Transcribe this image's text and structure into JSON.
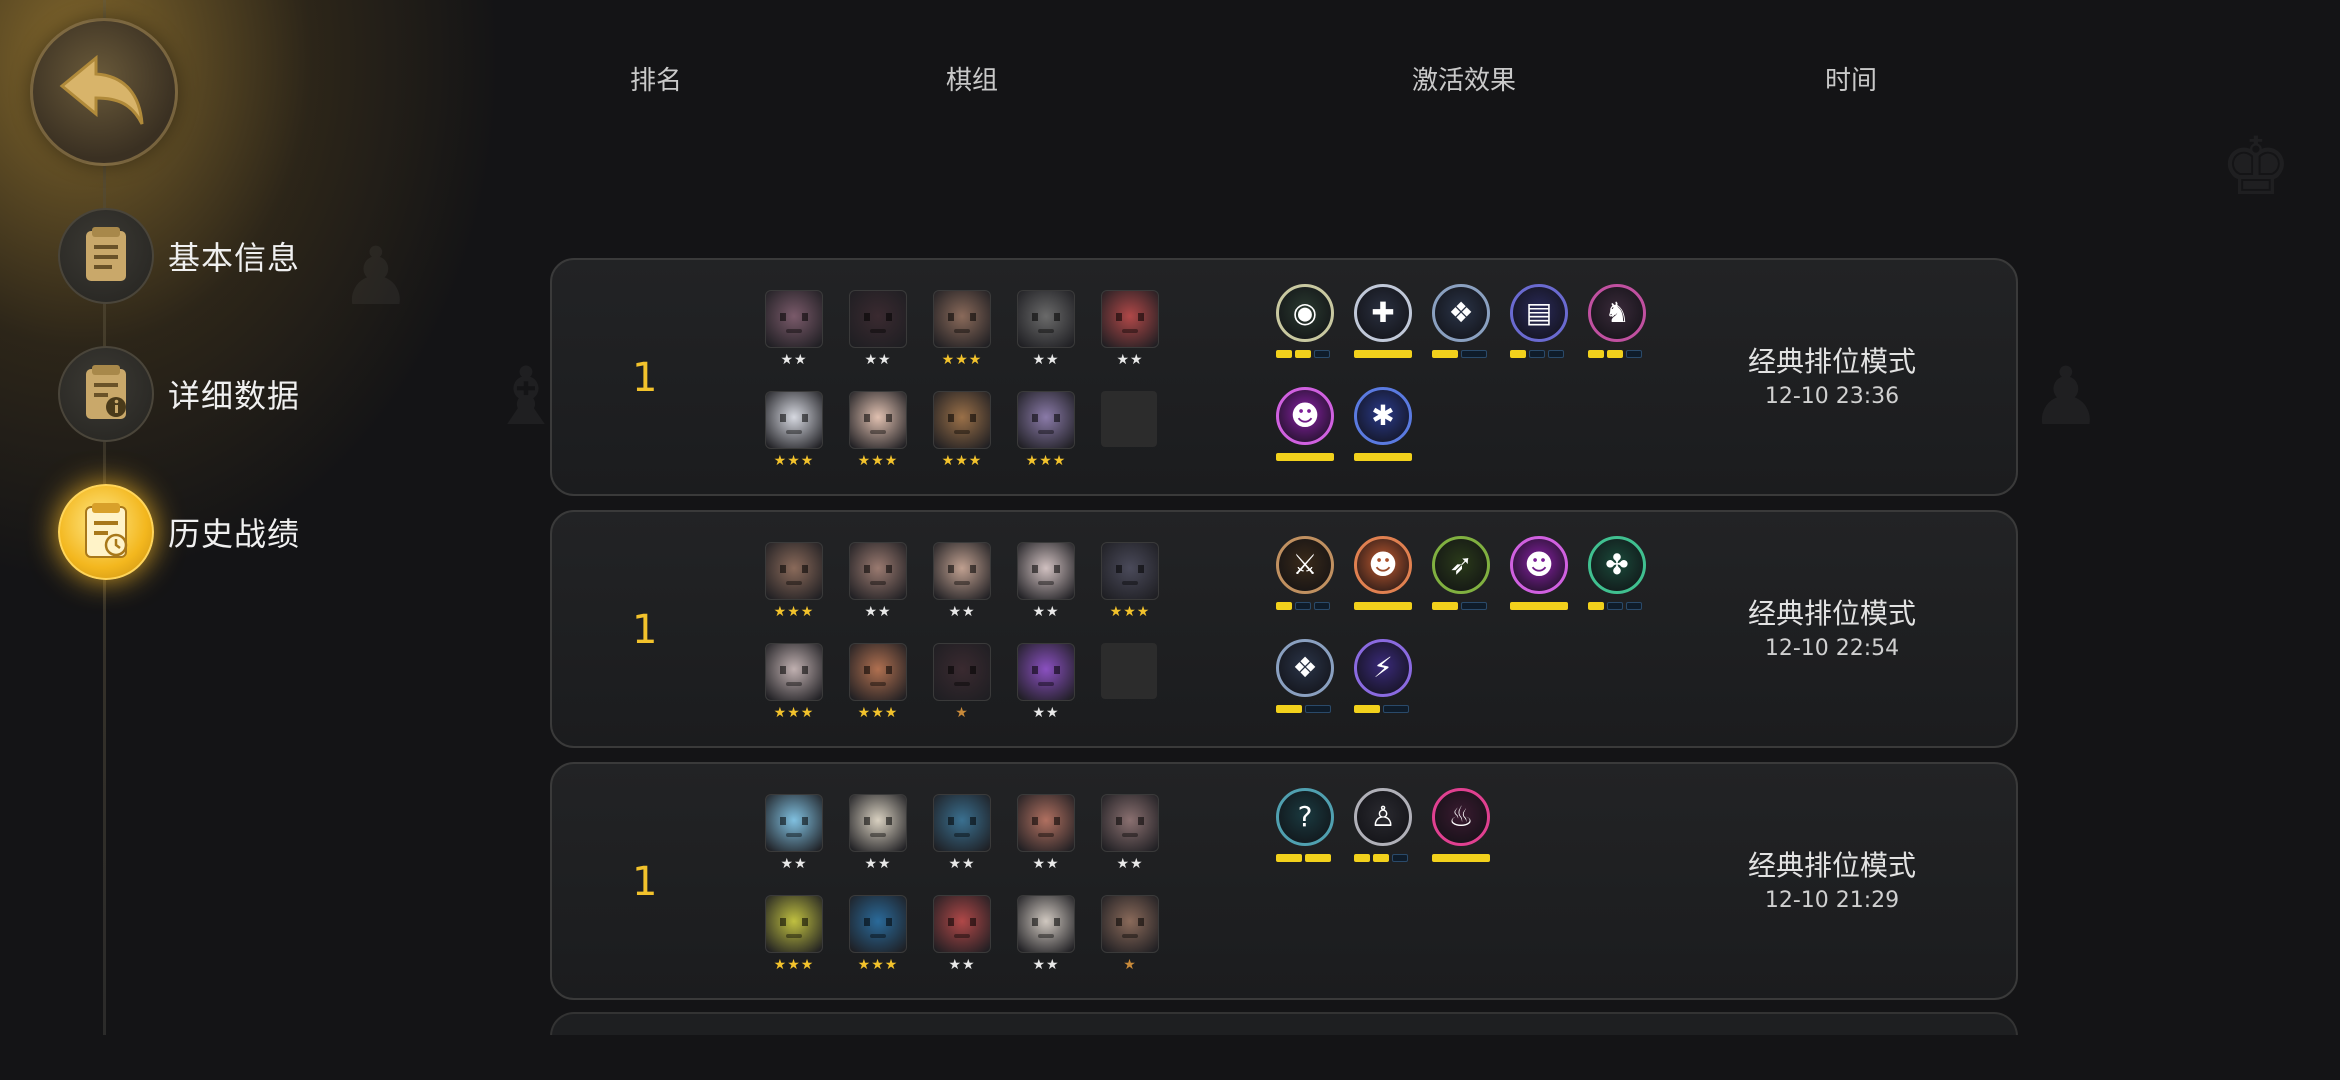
{
  "nav": {
    "back_icon": "back-arrow-icon",
    "items": [
      {
        "label": "基本信息",
        "icon": "document-icon",
        "active": false
      },
      {
        "label": "详细数据",
        "icon": "info-document-icon",
        "active": false
      },
      {
        "label": "历史战绩",
        "icon": "history-clock-icon",
        "active": true
      }
    ]
  },
  "columns": {
    "rank": "排名",
    "lineup": "棋组",
    "effects": "激活效果",
    "time": "时间"
  },
  "colors": {
    "accent_gold": "#f2c22c",
    "synergy_bar_on": "#f2d11c",
    "synergy_bar_off": "#0f1c2a"
  },
  "records": [
    {
      "rank": "1",
      "mode": "经典排位模式",
      "time": "12-10 23:36",
      "heroes": [
        {
          "stars": "★★",
          "tier": "white",
          "color": "#7a5a6a"
        },
        {
          "stars": "★★",
          "tier": "white",
          "color": "#3a2a30"
        },
        {
          "stars": "★★★",
          "tier": "gold",
          "color": "#8a6a5a"
        },
        {
          "stars": "★★",
          "tier": "white",
          "color": "#6a6a6a"
        },
        {
          "stars": "★★",
          "tier": "white",
          "color": "#b04848"
        },
        {
          "stars": "★★★",
          "tier": "gold",
          "color": "#d6d8e0"
        },
        {
          "stars": "★★★",
          "tier": "gold",
          "color": "#e0c0b0"
        },
        {
          "stars": "★★★",
          "tier": "gold",
          "color": "#9a7048"
        },
        {
          "stars": "★★★",
          "tier": "gold",
          "color": "#8a7aa8"
        }
      ],
      "empty_slots": 1,
      "synergies": [
        {
          "icon": "owl-icon",
          "glyph": "◉",
          "bg": "#2a3a30",
          "ring": "#c8c8a0",
          "bars": [
            1,
            1,
            0
          ]
        },
        {
          "icon": "cross-icon",
          "glyph": "✚",
          "bg": "#2a3040",
          "ring": "#c0c8d8",
          "bars": [
            1
          ]
        },
        {
          "icon": "paw-cluster-icon",
          "glyph": "❖",
          "bg": "#2a3448",
          "ring": "#8aa0c0",
          "bars": [
            1,
            0
          ]
        },
        {
          "icon": "book-icon",
          "glyph": "▤",
          "bg": "#2a2a5a",
          "ring": "#6a6ad0",
          "bars": [
            1,
            0,
            0
          ]
        },
        {
          "icon": "knight-icon",
          "glyph": "♞",
          "bg": "#3a2a3a",
          "ring": "#c050a0",
          "bars": [
            1,
            1,
            0
          ]
        },
        {
          "icon": "demon-icon",
          "glyph": "☻",
          "bg": "#8a20a8",
          "ring": "#d060e0",
          "bars": [
            1
          ]
        },
        {
          "icon": "shatter-icon",
          "glyph": "✱",
          "bg": "#2a3a8a",
          "ring": "#5a7ae0",
          "bars": [
            1
          ]
        }
      ]
    },
    {
      "rank": "1",
      "mode": "经典排位模式",
      "time": "12-10 22:54",
      "heroes": [
        {
          "stars": "★★★",
          "tier": "gold",
          "color": "#8a6a5a"
        },
        {
          "stars": "★★",
          "tier": "white",
          "color": "#9a7a70"
        },
        {
          "stars": "★★",
          "tier": "white",
          "color": "#c0a090"
        },
        {
          "stars": "★★",
          "tier": "white",
          "color": "#d0c0c0"
        },
        {
          "stars": "★★★",
          "tier": "gold",
          "color": "#4a4a5a"
        },
        {
          "stars": "★★★",
          "tier": "gold",
          "color": "#c0b0b0"
        },
        {
          "stars": "★★★",
          "tier": "gold",
          "color": "#b07050"
        },
        {
          "stars": "★",
          "tier": "bronze",
          "color": "#3a2a30"
        },
        {
          "stars": "★★",
          "tier": "white",
          "color": "#8a50c0"
        }
      ],
      "empty_slots": 1,
      "synergies": [
        {
          "icon": "beast-warrior-icon",
          "glyph": "⚔",
          "bg": "#3a2a1a",
          "ring": "#c09060",
          "bars": [
            1,
            0,
            0
          ]
        },
        {
          "icon": "horned-icon",
          "glyph": "☻",
          "bg": "#c05a30",
          "ring": "#e08050",
          "bars": [
            1
          ]
        },
        {
          "icon": "bow-icon",
          "glyph": "➶",
          "bg": "#2a3a1a",
          "ring": "#80b040",
          "bars": [
            1,
            0
          ]
        },
        {
          "icon": "demon-icon",
          "glyph": "☻",
          "bg": "#8a20a8",
          "ring": "#d060e0",
          "bars": [
            1
          ]
        },
        {
          "icon": "pawprint-icon",
          "glyph": "✤",
          "bg": "#1a4a3a",
          "ring": "#40c090",
          "bars": [
            1,
            0,
            0
          ]
        },
        {
          "icon": "paw-cluster-icon",
          "glyph": "❖",
          "bg": "#2a3448",
          "ring": "#8aa0c0",
          "bars": [
            1,
            0
          ]
        },
        {
          "icon": "fishbone-icon",
          "glyph": "⚡",
          "bg": "#3a2a7a",
          "ring": "#8a6ae0",
          "bars": [
            1,
            0
          ]
        }
      ]
    },
    {
      "rank": "1",
      "mode": "经典排位模式",
      "time": "12-10 21:29",
      "heroes": [
        {
          "stars": "★★",
          "tier": "white",
          "color": "#80c0e0"
        },
        {
          "stars": "★★",
          "tier": "white",
          "color": "#d8d0c0"
        },
        {
          "stars": "★★",
          "tier": "white",
          "color": "#3a7090"
        },
        {
          "stars": "★★",
          "tier": "white",
          "color": "#b07060"
        },
        {
          "stars": "★★",
          "tier": "white",
          "color": "#8a7070"
        },
        {
          "stars": "★★★",
          "tier": "gold",
          "color": "#c0c040"
        },
        {
          "stars": "★★★",
          "tier": "gold",
          "color": "#2a6a9a"
        },
        {
          "stars": "★★",
          "tier": "white",
          "color": "#b04848"
        },
        {
          "stars": "★★",
          "tier": "white",
          "color": "#d0c8c0"
        },
        {
          "stars": "★",
          "tier": "bronze",
          "color": "#8a6a5a"
        }
      ],
      "empty_slots": 0,
      "synergies": [
        {
          "icon": "question-icon",
          "glyph": "?",
          "bg": "#1a3a40",
          "ring": "#50a0b0",
          "bars": [
            1,
            1
          ]
        },
        {
          "icon": "pedestal-icon",
          "glyph": "♙",
          "bg": "#2a2a30",
          "ring": "#b0b0b8",
          "bars": [
            1,
            1,
            0
          ]
        },
        {
          "icon": "dragon-icon",
          "glyph": "♨",
          "bg": "#3a1a30",
          "ring": "#e04090",
          "bars": [
            1
          ]
        }
      ]
    }
  ]
}
